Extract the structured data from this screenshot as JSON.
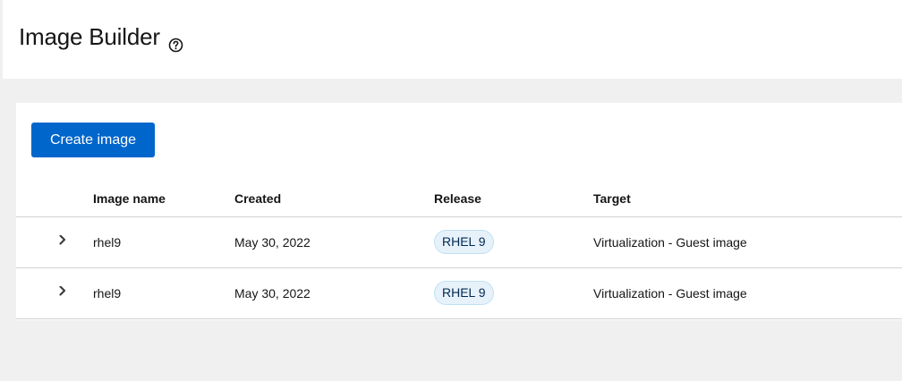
{
  "header": {
    "title": "Image Builder",
    "help_icon": "question-circle-icon"
  },
  "toolbar": {
    "create_label": "Create image"
  },
  "table": {
    "columns": [
      "Image name",
      "Created",
      "Release",
      "Target"
    ],
    "rows": [
      {
        "name": "rhel9",
        "created": "May 30, 2022",
        "release": "RHEL 9",
        "target": "Virtualization - Guest image"
      },
      {
        "name": "rhel9",
        "created": "May 30, 2022",
        "release": "RHEL 9",
        "target": "Virtualization - Guest image"
      }
    ]
  },
  "colors": {
    "primary": "#0066cc",
    "page_bg": "#f0f0f0",
    "badge_bg": "#e7f1fa",
    "badge_border": "#bee1f4",
    "border": "#d2d2d2"
  }
}
